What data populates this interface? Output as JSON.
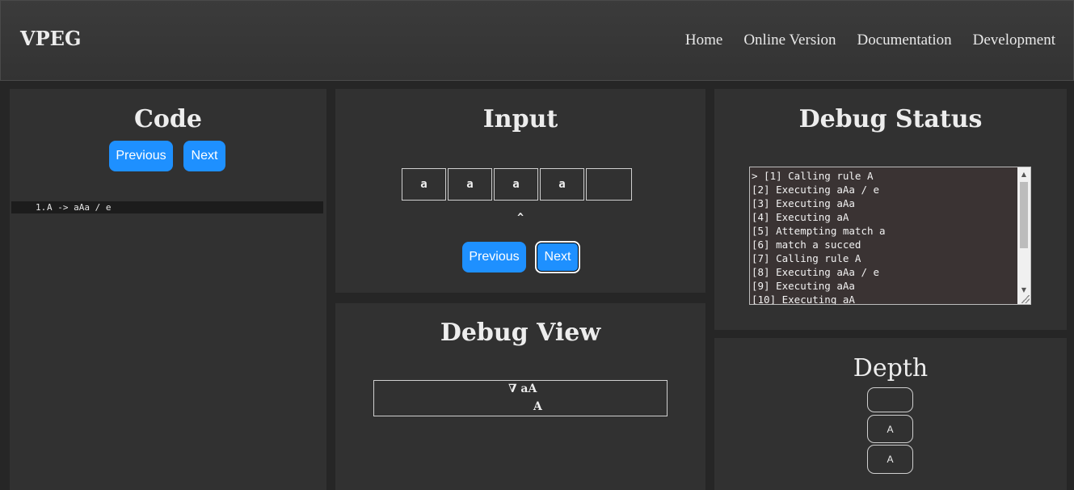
{
  "nav": {
    "brand": "VPEG",
    "links": [
      "Home",
      "Online Version",
      "Documentation",
      "Development"
    ]
  },
  "code": {
    "title": "Code",
    "prev_label": "Previous",
    "next_label": "Next",
    "lines": [
      {
        "num": "1.",
        "text": "A -> aAa / e"
      }
    ]
  },
  "input": {
    "title": "Input",
    "cells": [
      "a",
      "a",
      "a",
      "a",
      ""
    ],
    "caret": "^",
    "prev_label": "Previous",
    "next_label": "Next"
  },
  "debug_view": {
    "title": "Debug View",
    "row1": "∇ aA",
    "row2": "A"
  },
  "debug_status": {
    "title": "Debug Status",
    "lines": [
      "> [1] Calling rule A",
      "[2] Executing aAa / e",
      "[3] Executing aAa",
      "[4] Executing aA",
      "[5] Attempting match a",
      "[6] match a succed",
      "[7] Calling rule A",
      "[8] Executing aAa / e",
      "[9] Executing aAa",
      "[10] Executing aA"
    ]
  },
  "depth": {
    "title": "Depth",
    "items": [
      "",
      "A",
      "A"
    ]
  },
  "colors": {
    "accent": "#1e90ff",
    "background": "#262626",
    "panel": "#313131"
  }
}
